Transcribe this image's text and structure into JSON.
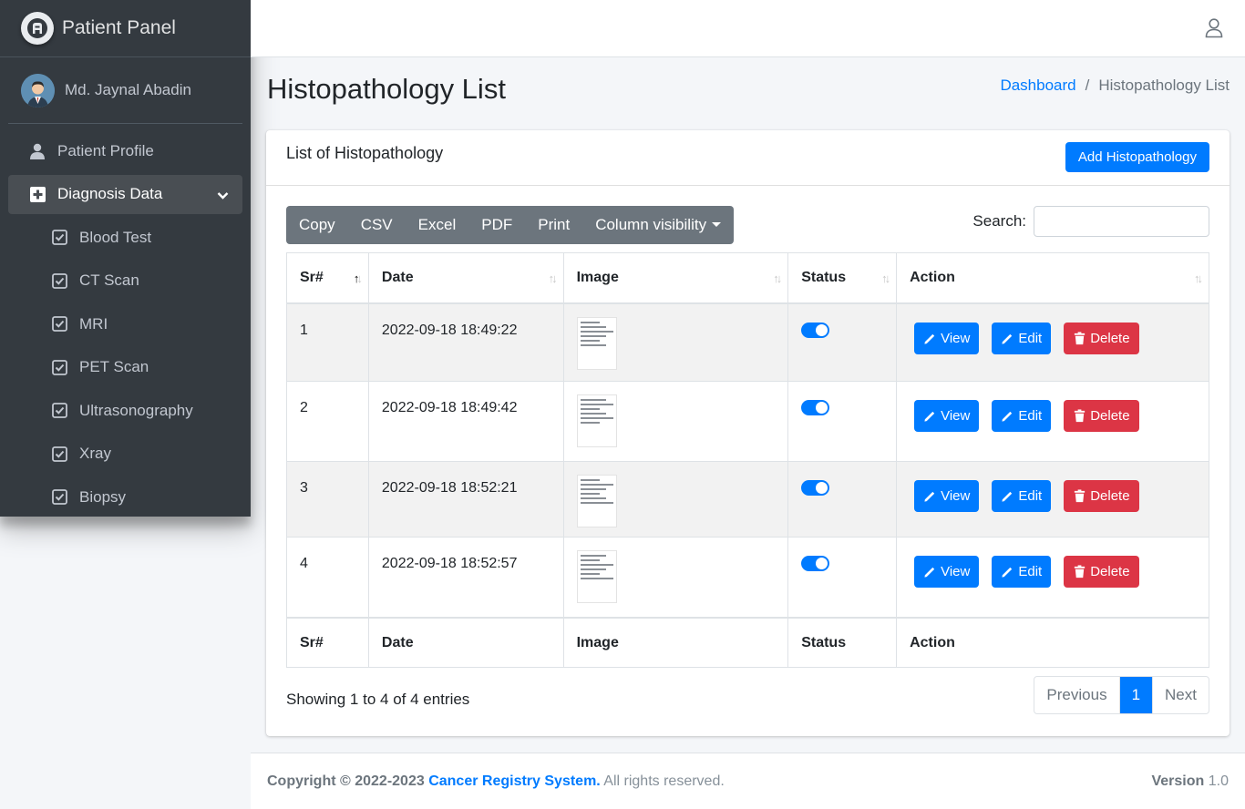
{
  "sidebar": {
    "brand": "Patient Panel",
    "user_name": "Md. Jaynal Abadin",
    "nav": {
      "profile": "Patient Profile",
      "diagnosis": "Diagnosis Data"
    },
    "sub_items": [
      "Blood Test",
      "CT Scan",
      "MRI",
      "PET Scan",
      "Ultrasonography",
      "Xray",
      "Biopsy"
    ]
  },
  "header": {
    "page_title": "Histopathology List",
    "breadcrumb_home": "Dashboard",
    "breadcrumb_sep": "/",
    "breadcrumb_current": "Histopathology List"
  },
  "card": {
    "title": "List of Histopathology",
    "add_button": "Add Histopathology",
    "export_buttons": [
      "Copy",
      "CSV",
      "Excel",
      "PDF",
      "Print"
    ],
    "column_visibility": "Column visibility",
    "search_label": "Search:",
    "search_value": ""
  },
  "table": {
    "columns": [
      "Sr#",
      "Date",
      "Image",
      "Status",
      "Action"
    ],
    "rows": [
      {
        "sr": "1",
        "date": "2022-09-18 18:49:22",
        "status": "on"
      },
      {
        "sr": "2",
        "date": "2022-09-18 18:49:42",
        "status": "on"
      },
      {
        "sr": "3",
        "date": "2022-09-18 18:52:21",
        "status": "on"
      },
      {
        "sr": "4",
        "date": "2022-09-18 18:52:57",
        "status": "on"
      }
    ],
    "action_labels": {
      "view": "View",
      "edit": "Edit",
      "delete": "Delete"
    }
  },
  "pagination": {
    "info": "Showing 1 to 4 of 4 entries",
    "previous": "Previous",
    "current": "1",
    "next": "Next"
  },
  "footer": {
    "copyright": "Copyright © 2022-2023",
    "system": "Cancer Registry System.",
    "rights": "All rights reserved.",
    "version_label": "Version",
    "version": "1.0"
  },
  "colors": {
    "primary": "#007bff",
    "danger": "#dc3545",
    "sidebar": "#343a40"
  }
}
